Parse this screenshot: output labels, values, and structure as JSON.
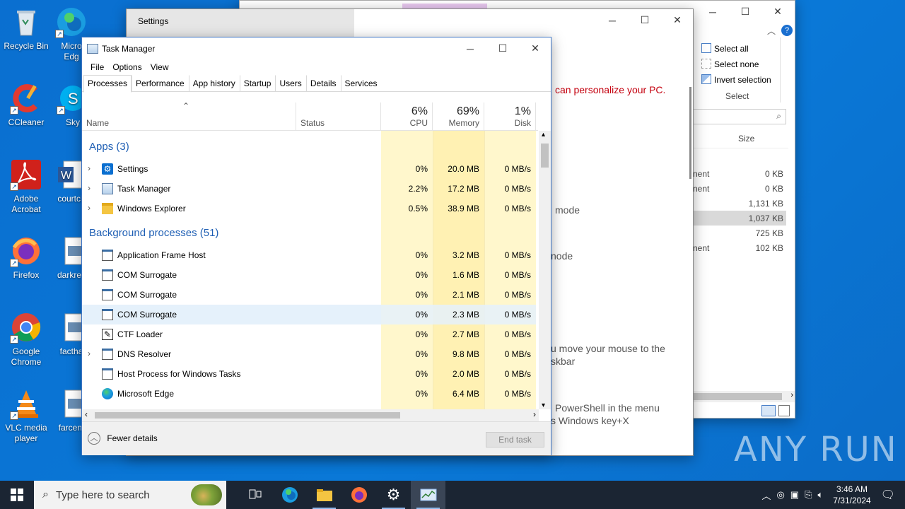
{
  "desktop": {
    "icons": [
      {
        "label": "Recycle Bin"
      },
      {
        "label": "Micro Edg"
      },
      {
        "label": "CCleaner"
      },
      {
        "label": "Sky"
      },
      {
        "label": "Adobe Acrobat"
      },
      {
        "label": "courtch"
      },
      {
        "label": "Firefox"
      },
      {
        "label": "darkres"
      },
      {
        "label": "Google Chrome"
      },
      {
        "label": "factha"
      },
      {
        "label": "VLC media player"
      },
      {
        "label": "farcent"
      }
    ],
    "watermark": "ANY RUN"
  },
  "explorer": {
    "ribbon": {
      "select_all": "Select all",
      "select_none": "Select none",
      "invert_selection": "Invert selection",
      "group_label": "Select"
    },
    "column_size": "Size",
    "rows": [
      {
        "type": "nent",
        "size": "0 KB"
      },
      {
        "type": "nent",
        "size": "0 KB"
      },
      {
        "type": "",
        "size": "1,131 KB"
      },
      {
        "type": "",
        "size": "1,037 KB"
      },
      {
        "type": "",
        "size": "725 KB"
      },
      {
        "type": "nent",
        "size": "102 KB"
      }
    ]
  },
  "settings": {
    "title": "Settings",
    "text_personalize": "can personalize your PC.",
    "text_mode1": "mode",
    "text_mode2": "node",
    "text_mouse": "u move your mouse to the",
    "text_mouse2": "skbar",
    "text_ps1": "PowerShell in the menu",
    "text_ps2": "s Windows key+X"
  },
  "taskmgr": {
    "title": "Task Manager",
    "menu": [
      "File",
      "Options",
      "View"
    ],
    "tabs": [
      "Processes",
      "Performance",
      "App history",
      "Startup",
      "Users",
      "Details",
      "Services"
    ],
    "active_tab": "Processes",
    "columns": {
      "name": "Name",
      "status": "Status",
      "cpu": {
        "pct": "6%",
        "label": "CPU"
      },
      "memory": {
        "pct": "69%",
        "label": "Memory"
      },
      "disk": {
        "pct": "1%",
        "label": "Disk"
      }
    },
    "apps_group": "Apps (3)",
    "apps": [
      {
        "name": "Settings",
        "cpu": "0%",
        "memory": "20.0 MB",
        "disk": "0 MB/s"
      },
      {
        "name": "Task Manager",
        "cpu": "2.2%",
        "memory": "17.2 MB",
        "disk": "0 MB/s"
      },
      {
        "name": "Windows Explorer",
        "cpu": "0.5%",
        "memory": "38.9 MB",
        "disk": "0 MB/s"
      }
    ],
    "bg_group": "Background processes (51)",
    "bg": [
      {
        "name": "Application Frame Host",
        "cpu": "0%",
        "memory": "3.2 MB",
        "disk": "0 MB/s"
      },
      {
        "name": "COM Surrogate",
        "cpu": "0%",
        "memory": "1.6 MB",
        "disk": "0 MB/s"
      },
      {
        "name": "COM Surrogate",
        "cpu": "0%",
        "memory": "2.1 MB",
        "disk": "0 MB/s"
      },
      {
        "name": "COM Surrogate",
        "cpu": "0%",
        "memory": "2.3 MB",
        "disk": "0 MB/s"
      },
      {
        "name": "CTF Loader",
        "cpu": "0%",
        "memory": "2.7 MB",
        "disk": "0 MB/s"
      },
      {
        "name": "DNS Resolver",
        "cpu": "0%",
        "memory": "9.8 MB",
        "disk": "0 MB/s"
      },
      {
        "name": "Host Process for Windows Tasks",
        "cpu": "0%",
        "memory": "2.0 MB",
        "disk": "0 MB/s"
      },
      {
        "name": "Microsoft Edge",
        "cpu": "0%",
        "memory": "6.4 MB",
        "disk": "0 MB/s"
      }
    ],
    "fewer_details": "Fewer details",
    "end_task": "End task"
  },
  "taskbar": {
    "search_placeholder": "Type here to search",
    "time": "3:46 AM",
    "date": "7/31/2024"
  }
}
